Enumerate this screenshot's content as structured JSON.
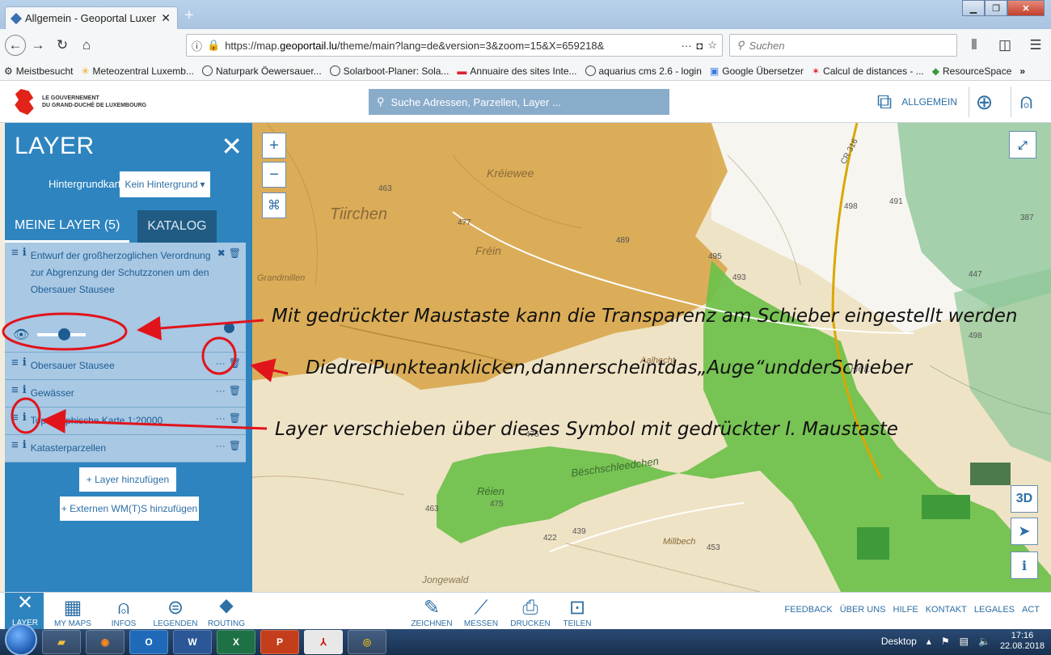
{
  "browser": {
    "tab_title": "Allgemein - Geoportal Luxemb",
    "url_prefix": "https://map.",
    "url_domain": "geoportail.lu",
    "url_rest": "/theme/main?lang=de&version=3&zoom=15&X=659218&",
    "search_placeholder": "Suchen",
    "bookmarks": [
      "Meistbesucht",
      "Meteozentral Luxemb...",
      "Naturpark Öewersauer...",
      "Solarboot-Planer: Sola...",
      "Annuaire des sites Inte...",
      "aquarius cms 2.6 - login",
      "Google Übersetzer",
      "Calcul de distances - ...",
      "ResourceSpace"
    ]
  },
  "header": {
    "logo_line1": "LE GOUVERNEMENT",
    "logo_line2": "DU GRAND-DUCHÉ DE LUXEMBOURG",
    "search_placeholder": "Suche Adressen, Parzellen, Layer ...",
    "theme_label": "ALLGEMEIN"
  },
  "panel": {
    "title": "LAYER",
    "background_label": "Hintergrundkarte:",
    "background_value": "Kein Hintergrund",
    "tab_my_layers": "MEINE LAYER (5)",
    "tab_catalog": "KATALOG",
    "layers": [
      {
        "name": "Entwurf der großherzoglichen Verordnung zur Abgrenzung der Schutzzonen um den Obersauer Stausee"
      },
      {
        "name": "Obersauer Stausee"
      },
      {
        "name": "Gewässer"
      },
      {
        "name": "Topographische Karte 1:20000"
      },
      {
        "name": "Katasterparzellen"
      }
    ],
    "add_layer": "+ Layer hinzufügen",
    "add_external": "+ Externen WM(T)S hinzufügen"
  },
  "map": {
    "place_labels": [
      "Kréiewee",
      "Tiirchen",
      "Fréin",
      "Réien",
      "Bëschschleedchen",
      "Jongewald",
      "Hélt",
      "Grandmillen",
      "Aalhecht",
      "Millbech"
    ],
    "contour_labels": [
      "463",
      "477",
      "489",
      "495",
      "493",
      "498",
      "491",
      "387",
      "447",
      "498",
      "463",
      "475",
      "475",
      "439",
      "422",
      "453"
    ],
    "road_label": "CR 316",
    "right_controls": [
      "3D",
      "i"
    ]
  },
  "annotations": {
    "slider_note": "Mit gedrückter Maustaste kann die Transparenz am Schieber eingestellt werden",
    "dots_note": "DiedreiPunkteanklicken,dannerscheintdas„Auge“undderSchieber",
    "move_note": "Layer verschieben über dieses Symbol mit gedrückter l. Maustaste"
  },
  "toolbar": {
    "left": [
      "LAYER",
      "MY MAPS",
      "INFOS",
      "LEGENDEN",
      "ROUTING"
    ],
    "center": [
      "ZEICHNEN",
      "MESSEN",
      "DRUCKEN",
      "TEILEN"
    ],
    "links": [
      "FEEDBACK",
      "ÜBER UNS",
      "HILFE",
      "KONTAKT",
      "LEGALES",
      "ACT"
    ]
  },
  "taskbar": {
    "desktop_label": "Desktop",
    "time": "17:16",
    "date": "22.08.2018"
  },
  "colors": {
    "panel_blue": "#2e84bf",
    "layer_row": "#a8c8e4",
    "orange_zone": "#d9a84e",
    "green_zone": "#6cc04a",
    "annotation_red": "#e1141b"
  }
}
